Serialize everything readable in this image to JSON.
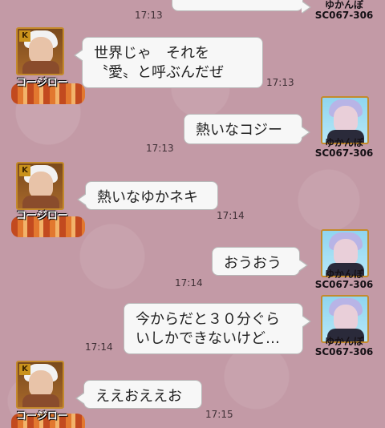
{
  "messages": [
    {
      "text": "",
      "time": "17:13"
    },
    {
      "text": "世界じゃ　それを\n〝愛〟と呼ぶんだぜ",
      "time": "17:13"
    },
    {
      "text": "熱いなコジー",
      "time": "17:13"
    },
    {
      "text": "熱いなゆかネキ",
      "time": "17:14"
    },
    {
      "text": "おうおう",
      "time": "17:14"
    },
    {
      "text": "今からだと３０分ぐら\nいしかできないけど…",
      "time": "17:14"
    },
    {
      "text": "ええおええお",
      "time": "17:15"
    }
  ],
  "users": {
    "koji": {
      "name": "コージロー",
      "badge": "K"
    },
    "yuka": {
      "name": "ゆかんぼ",
      "id": "SC067-306"
    }
  },
  "colors": {
    "background": "#c39aa6",
    "bubble": "#f7f7f7"
  }
}
